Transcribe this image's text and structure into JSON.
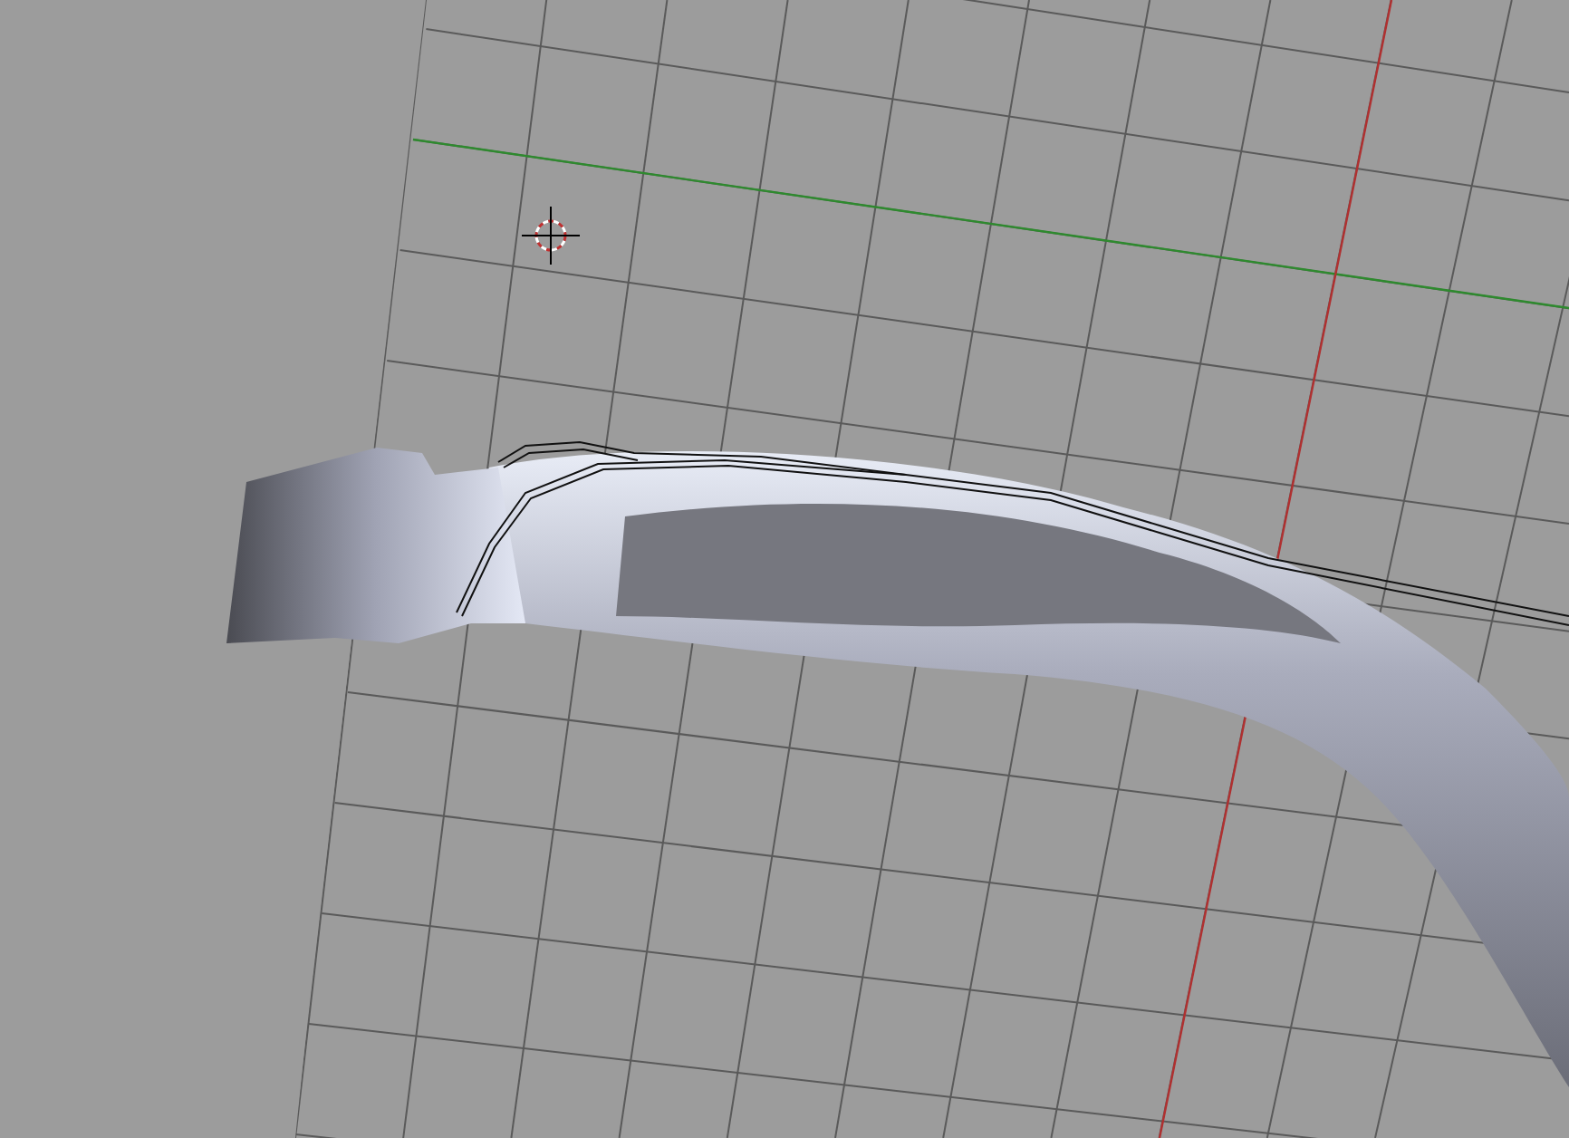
{
  "viewport": {
    "show_grid": true,
    "show_axes": true,
    "show_cursor": true,
    "show_object": true,
    "show_curve": true
  }
}
